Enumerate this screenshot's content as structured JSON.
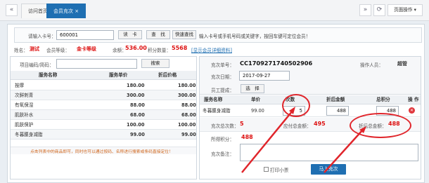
{
  "tabs": [
    {
      "label": "访问首页"
    },
    {
      "label": "会员充次 ×"
    }
  ],
  "toolbar": {
    "page_ops": "页面操作 ▾",
    "refresh": "⟳",
    "prev": "«",
    "next": "»",
    "left": "«"
  },
  "card_search": {
    "label": "请输入卡号：",
    "value": "600001",
    "read_card": "读　卡",
    "search": "查　找",
    "quick_search": "快速查找",
    "hint": "输入卡号或手机号码或关键字，按回车键可定位会员！"
  },
  "member": {
    "name_label": "姓名：",
    "name": "测试",
    "level_label": "会员等级：",
    "level": "金卡等级",
    "balance_label": "余额：",
    "balance": "536.00",
    "points_label": "积分数量：",
    "points": "5568",
    "detail_link": "[显示会员详细资料]"
  },
  "service_search": {
    "label": "项目编码/简码：",
    "search_btn": "搜索"
  },
  "service_table": {
    "headers": [
      "服务名称",
      "服务单价",
      "折后价格"
    ],
    "rows": [
      [
        "按摩",
        "180.00",
        "180.00"
      ],
      [
        "次鲜刺青",
        "300.00",
        "300.00"
      ],
      [
        "有氧保湿",
        "88.00",
        "88.00"
      ],
      [
        "肌肤补水",
        "68.00",
        "68.00"
      ],
      [
        "肌肤保护",
        "100.00",
        "100.00"
      ],
      [
        "冬暮腰身减脂",
        "99.00",
        "99.00"
      ]
    ],
    "footer_hint": "点击列表中的商品即可，同时也可以通过按码、名称进行搜索或条码直接定位！"
  },
  "recharge": {
    "order_label": "充次单号：",
    "order_no": "CC1709271740502906",
    "operator_label": "操作人员：",
    "operator": "超管",
    "date_label": "充次日期：",
    "date": "2017-09-27",
    "staff_label": "员工提成：",
    "staff_btn": "选　择",
    "table_headers": [
      "服务名称",
      "单价",
      "次数",
      "折后金额",
      "总积分",
      "操 作"
    ],
    "row": {
      "name": "冬暮腰身减脂",
      "price": "99.00",
      "count": "5",
      "amount": "488",
      "points": "488"
    },
    "total_count_label": "充次总次数：",
    "total_count": "5",
    "total_amount_label": "应付总金额：",
    "total_amount": "495",
    "discount_amount_label": "折后总金额：",
    "discount_amount": "488",
    "points_label": "所得积分：",
    "points": "488",
    "remark_label": "充次备注：",
    "print_label": "打印小票",
    "submit_btn": "马上充次"
  },
  "colors": {
    "accent": "#1f6fb2",
    "highlight": "#e0252b"
  }
}
